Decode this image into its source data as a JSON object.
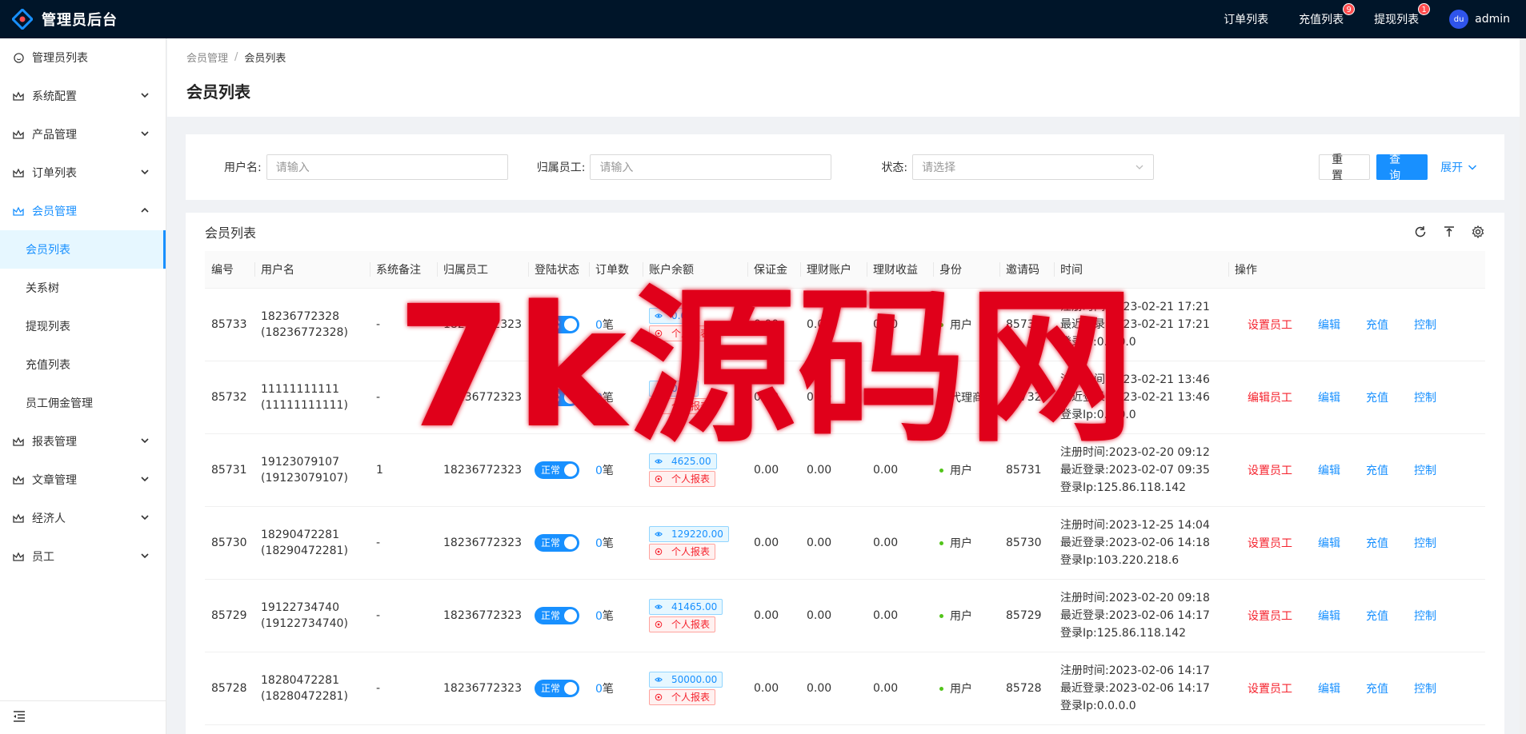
{
  "app": {
    "title": "管理员后台"
  },
  "header": {
    "items": [
      {
        "label": "订单列表",
        "badge": null
      },
      {
        "label": "充值列表",
        "badge": "9"
      },
      {
        "label": "提现列表",
        "badge": "1"
      }
    ],
    "user": {
      "name": "admin",
      "avatar_text": "du"
    }
  },
  "sidebar": {
    "items": [
      {
        "label": "管理员列表",
        "icon": "smile-icon"
      },
      {
        "label": "系统配置",
        "icon": "crown-icon"
      },
      {
        "label": "产品管理",
        "icon": "crown-icon"
      },
      {
        "label": "订单列表",
        "icon": "crown-icon"
      },
      {
        "label": "会员管理",
        "icon": "crown-icon"
      },
      {
        "label": "报表管理",
        "icon": "crown-icon"
      },
      {
        "label": "文章管理",
        "icon": "crown-icon"
      },
      {
        "label": "经济人",
        "icon": "crown-icon"
      },
      {
        "label": "员工",
        "icon": "crown-icon"
      }
    ],
    "sub_items": [
      "会员列表",
      "关系树",
      "提现列表",
      "充值列表",
      "员工佣金管理"
    ]
  },
  "breadcrumb": {
    "parent": "会员管理",
    "sep": "/",
    "current": "会员列表"
  },
  "page": {
    "title": "会员列表"
  },
  "search": {
    "username_label": "用户名:",
    "username_placeholder": "请输入",
    "staff_label": "归属员工:",
    "staff_placeholder": "请输入",
    "status_label": "状态:",
    "status_placeholder": "请选择",
    "reset_label": "重 置",
    "query_label": "查 询",
    "expand_label": "展开"
  },
  "table": {
    "title": "会员列表",
    "columns": [
      "编号",
      "用户名",
      "系统备注",
      "归属员工",
      "登陆状态",
      "订单数",
      "账户余额",
      "保证金",
      "理财账户",
      "理财收益",
      "身份",
      "邀请码",
      "时间",
      "操作"
    ],
    "switch_label": "正常",
    "order_unit": "笔",
    "report_label": "个人报表",
    "reg_prefix": "注册时间:",
    "login_prefix": "最近登录:",
    "ip_prefix": "登录Ip:",
    "ops": {
      "edit": "编辑",
      "recharge": "充值",
      "control": "控制"
    },
    "rows": [
      {
        "id": "85733",
        "user": "18236772328",
        "user_sub": "(18236772328)",
        "remark": "-",
        "staff": "18236772323",
        "orders": "0",
        "balance": "0.00",
        "deposit": "0.00",
        "finance": "0.00",
        "income": "0.00",
        "role": "用户",
        "invite": "85733",
        "reg": "2023-02-21 17:21",
        "login": "2023-02-21 17:21",
        "ip": "0.0.0.0",
        "staff_op": "设置员工"
      },
      {
        "id": "85732",
        "user": "11111111111",
        "user_sub": "(11111111111)",
        "remark": "-",
        "staff": "18236772323",
        "orders": "0",
        "balance": "0.00",
        "deposit": "0.00",
        "finance": "0.00",
        "income": "0.00",
        "role": "代理商",
        "invite": "85732",
        "reg": "2023-02-21 13:46",
        "login": "2023-02-21 13:46",
        "ip": "0.0.0.0",
        "staff_op": "编辑员工"
      },
      {
        "id": "85731",
        "user": "19123079107",
        "user_sub": "(19123079107)",
        "remark": "1",
        "staff": "18236772323",
        "orders": "0",
        "balance": "4625.00",
        "deposit": "0.00",
        "finance": "0.00",
        "income": "0.00",
        "role": "用户",
        "invite": "85731",
        "reg": "2023-02-20 09:12",
        "login": "2023-02-07 09:35",
        "ip": "125.86.118.142",
        "staff_op": "设置员工"
      },
      {
        "id": "85730",
        "user": "18290472281",
        "user_sub": "(18290472281)",
        "remark": "-",
        "staff": "18236772323",
        "orders": "0",
        "balance": "129220.00",
        "deposit": "0.00",
        "finance": "0.00",
        "income": "0.00",
        "role": "用户",
        "invite": "85730",
        "reg": "2023-12-25 14:04",
        "login": "2023-02-06 14:18",
        "ip": "103.220.218.6",
        "staff_op": "设置员工"
      },
      {
        "id": "85729",
        "user": "19122734740",
        "user_sub": "(19122734740)",
        "remark": "-",
        "staff": "18236772323",
        "orders": "0",
        "balance": "41465.00",
        "deposit": "0.00",
        "finance": "0.00",
        "income": "0.00",
        "role": "用户",
        "invite": "85729",
        "reg": "2023-02-20 09:18",
        "login": "2023-02-06 14:17",
        "ip": "125.86.118.142",
        "staff_op": "设置员工"
      },
      {
        "id": "85728",
        "user": "18280472281",
        "user_sub": "(18280472281)",
        "remark": "-",
        "staff": "18236772323",
        "orders": "0",
        "balance": "50000.00",
        "deposit": "0.00",
        "finance": "0.00",
        "income": "0.00",
        "role": "用户",
        "invite": "85728",
        "reg": "2023-02-06 14:17",
        "login": "2023-02-06 14:17",
        "ip": "0.0.0.0",
        "staff_op": "设置员工"
      }
    ]
  },
  "watermark": "7k源码网",
  "colors": {
    "header_bg": "#001529",
    "accent": "#1890ff",
    "danger": "#f5222d",
    "watermark": "#e0001a"
  }
}
